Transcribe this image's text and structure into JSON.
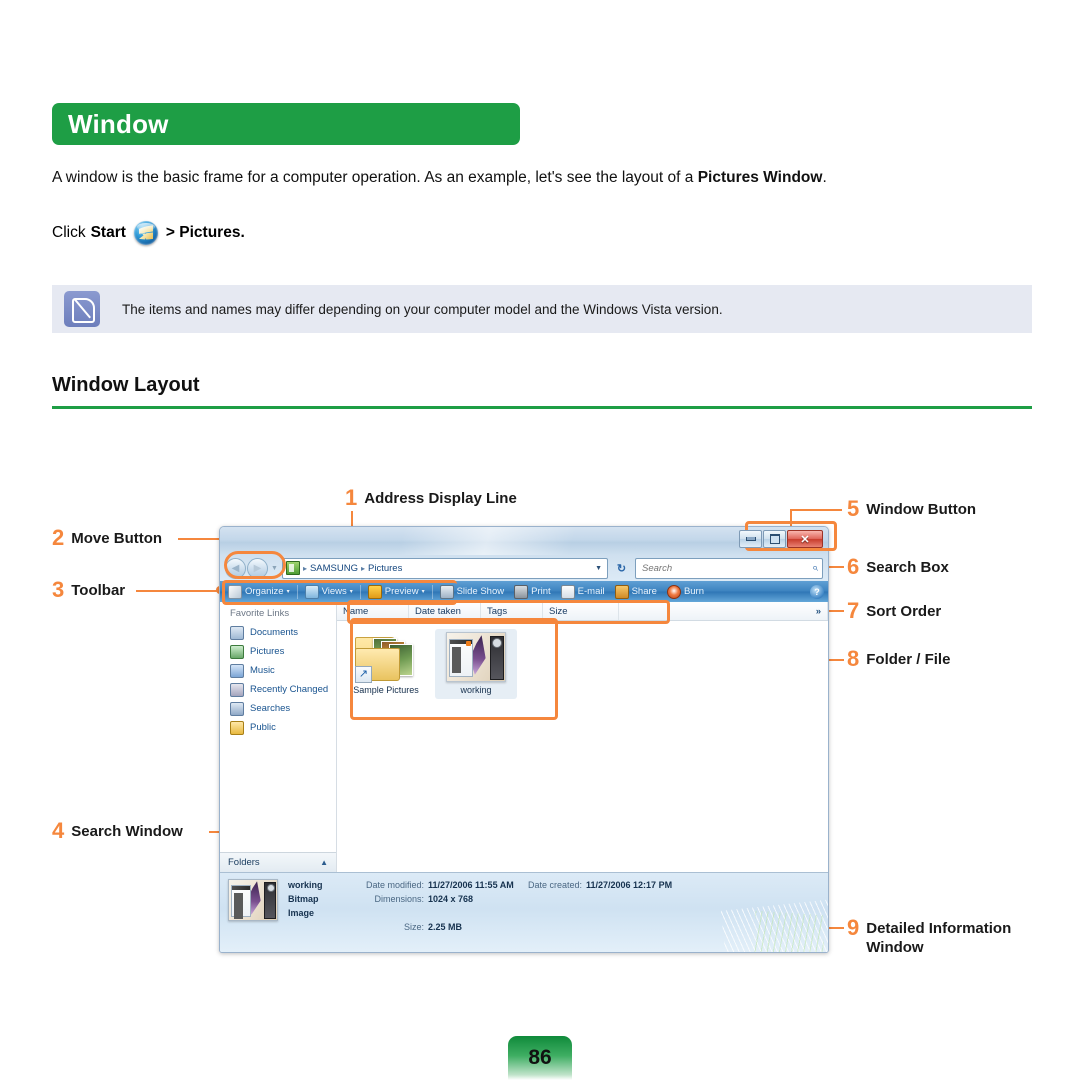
{
  "doc": {
    "title": "Window",
    "intro_before": "A window is the basic frame for a computer operation. As an example, let's see the layout of a ",
    "intro_bold": "Pictures Window",
    "intro_after": ".",
    "click_prefix": "Click ",
    "click_start": "Start",
    "click_suffix": "> Pictures.",
    "note": "The items and names may differ depending on your computer model and the Windows Vista version.",
    "section_heading": "Window Layout",
    "page_number": "86",
    "accent_green": "#1e9e45",
    "accent_orange": "#f5873d"
  },
  "callouts": [
    {
      "num": "1",
      "label": "Address Display Line"
    },
    {
      "num": "2",
      "label": "Move Button"
    },
    {
      "num": "3",
      "label": "Toolbar"
    },
    {
      "num": "4",
      "label": "Search Window"
    },
    {
      "num": "5",
      "label": "Window Button"
    },
    {
      "num": "6",
      "label": "Search Box"
    },
    {
      "num": "7",
      "label": "Sort Order"
    },
    {
      "num": "8",
      "label": "Folder / File"
    },
    {
      "num": "9",
      "label": "Detailed Information",
      "label2": "Window"
    }
  ],
  "explorer": {
    "window_buttons": {
      "minimize": "—",
      "maximize": "❐",
      "close": "✕"
    },
    "nav": {
      "back": "◀",
      "forward": "▶",
      "history_caret": "▼"
    },
    "address": {
      "crumbs": [
        "SAMSUNG",
        "Pictures"
      ],
      "separator": "▸",
      "dropdown_caret": "▼",
      "refresh": "↻"
    },
    "search": {
      "placeholder": "Search",
      "icon": "⌕"
    },
    "toolbar": {
      "items": [
        {
          "label": "Organize",
          "caret": "▾",
          "icon": "organize-icon"
        },
        {
          "label": "Views",
          "caret": "▾",
          "icon": "views-icon"
        },
        {
          "label": "Preview",
          "caret": "▾",
          "icon": "preview-icon"
        },
        {
          "label": "Slide Show",
          "caret": "",
          "icon": "slideshow-icon"
        },
        {
          "label": "Print",
          "caret": "",
          "icon": "print-icon"
        },
        {
          "label": "E-mail",
          "caret": "",
          "icon": "email-icon"
        },
        {
          "label": "Share",
          "caret": "",
          "icon": "share-icon"
        },
        {
          "label": "Burn",
          "caret": "",
          "icon": "burn-icon"
        }
      ],
      "help": "?"
    },
    "sidebar": {
      "title": "Favorite Links",
      "items": [
        {
          "label": "Documents"
        },
        {
          "label": "Pictures"
        },
        {
          "label": "Music"
        },
        {
          "label": "Recently Changed"
        },
        {
          "label": "Searches"
        },
        {
          "label": "Public"
        }
      ],
      "folders_label": "Folders",
      "folders_chevron": "▲"
    },
    "columns": [
      {
        "label": "Name"
      },
      {
        "label": "Date taken"
      },
      {
        "label": "Tags"
      },
      {
        "label": "Size"
      },
      {
        "label": "»"
      }
    ],
    "files": [
      {
        "label": "Sample Pictures",
        "type": "folder-shortcut",
        "shortcut_glyph": "↗"
      },
      {
        "label": "working",
        "type": "bitmap",
        "selected": true
      }
    ],
    "detail": {
      "file_name": "working",
      "file_type": "Bitmap Image",
      "fields": [
        {
          "label": "Date modified:",
          "value": "11/27/2006 11:55 AM"
        },
        {
          "label": "Dimensions:",
          "value": "1024 x 768"
        },
        {
          "label": "Size:",
          "value": "2.25 MB"
        }
      ],
      "right_fields": [
        {
          "label": "Date created:",
          "value": "11/27/2006 12:17 PM"
        }
      ]
    }
  }
}
